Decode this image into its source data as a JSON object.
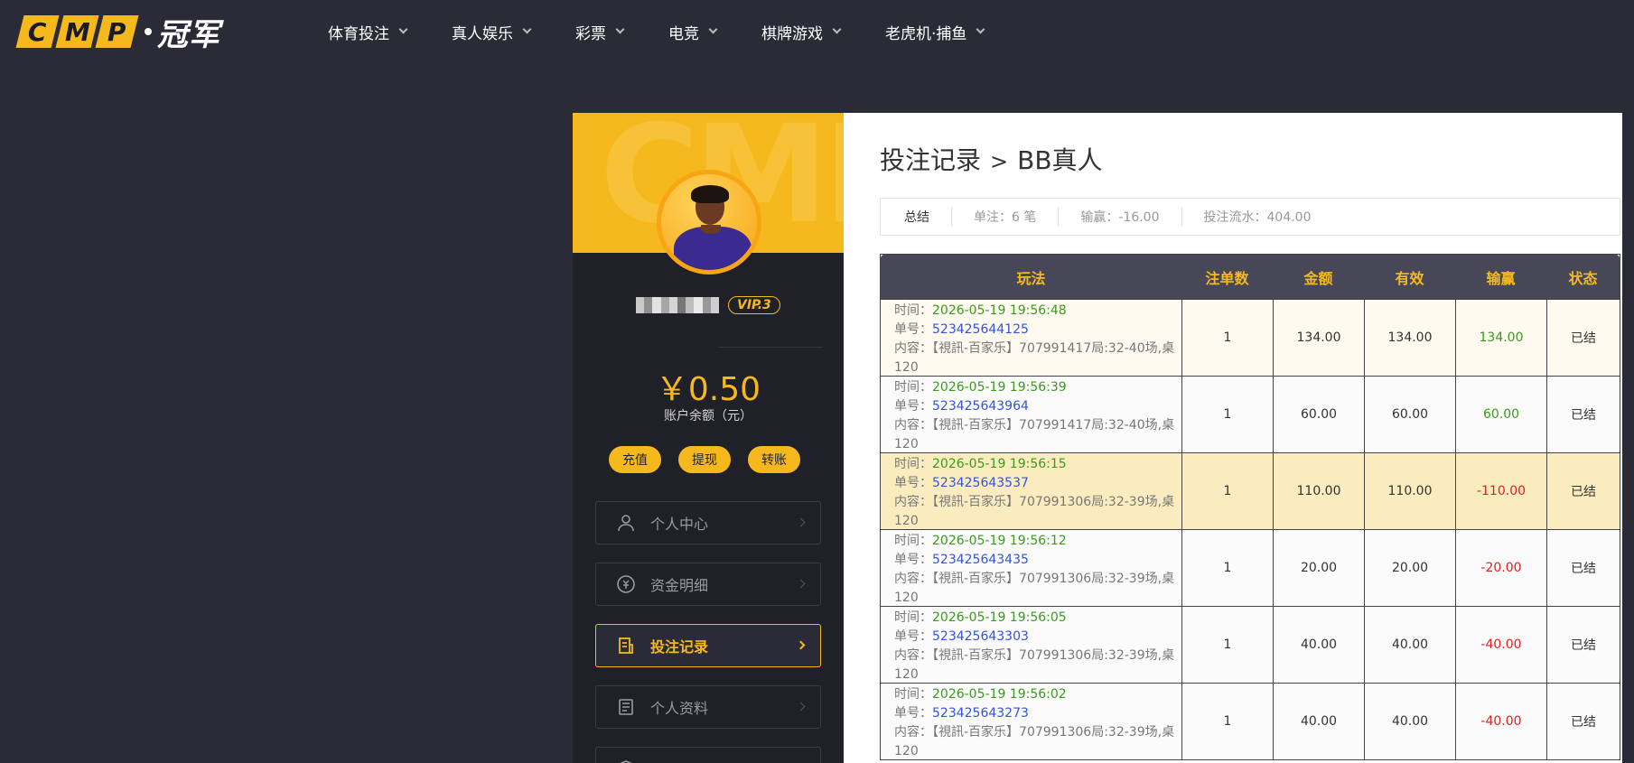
{
  "brand": {
    "logo_letters": [
      "C",
      "M",
      "P"
    ],
    "logo_cn": "冠军",
    "banner_watermark": "CMP"
  },
  "nav": {
    "items": [
      {
        "label": "体育投注"
      },
      {
        "label": "真人娱乐"
      },
      {
        "label": "彩票"
      },
      {
        "label": "电竞"
      },
      {
        "label": "棋牌游戏"
      },
      {
        "label": "老虎机·捕鱼"
      }
    ]
  },
  "user": {
    "vip": "VIP.3",
    "balance": "￥0.50",
    "balance_label": "账户余额（元）"
  },
  "actions": {
    "deposit": "充值",
    "withdraw": "提现",
    "transfer": "转账"
  },
  "menu": {
    "items": [
      {
        "label": "个人中心",
        "icon": "user-icon"
      },
      {
        "label": "资金明细",
        "icon": "money-cycle-icon"
      },
      {
        "label": "投注记录",
        "icon": "bet-record-icon",
        "active": true
      },
      {
        "label": "个人资料",
        "icon": "profile-doc-icon"
      }
    ]
  },
  "page": {
    "title_main": "投注记录",
    "title_sep": ">",
    "title_sub": "BB真人"
  },
  "summary": {
    "label": "总结",
    "bets": "单注：6 笔",
    "winloss": "输赢：-16.00",
    "turnover": "投注流水：404.00"
  },
  "table": {
    "headers": [
      "玩法",
      "注单数",
      "金额",
      "有效",
      "输赢",
      "状态"
    ],
    "time_label": "时间：",
    "no_label": "单号：",
    "content_label": "内容：",
    "rows": [
      {
        "time": "2026-05-19 19:56:48",
        "no": "523425644125",
        "content": "【視訊-百家乐】707991417局:32-40场,桌",
        "content2": "120",
        "count": "1",
        "amount": "134.00",
        "valid": "134.00",
        "winloss": "134.00",
        "status": "已结"
      },
      {
        "time": "2026-05-19 19:56:39",
        "no": "523425643964",
        "content": "【視訊-百家乐】707991417局:32-40场,桌",
        "content2": "120",
        "count": "1",
        "amount": "60.00",
        "valid": "60.00",
        "winloss": "60.00",
        "status": "已结"
      },
      {
        "time": "2026-05-19 19:56:15",
        "no": "523425643537",
        "content": "【視訊-百家乐】707991306局:32-39场,桌",
        "content2": "120",
        "count": "1",
        "amount": "110.00",
        "valid": "110.00",
        "winloss": "-110.00",
        "status": "已结"
      },
      {
        "time": "2026-05-19 19:56:12",
        "no": "523425643435",
        "content": "【視訊-百家乐】707991306局:32-39场,桌",
        "content2": "120",
        "count": "1",
        "amount": "20.00",
        "valid": "20.00",
        "winloss": "-20.00",
        "status": "已结"
      },
      {
        "time": "2026-05-19 19:56:05",
        "no": "523425643303",
        "content": "【視訊-百家乐】707991306局:32-39场,桌",
        "content2": "120",
        "count": "1",
        "amount": "40.00",
        "valid": "40.00",
        "winloss": "-40.00",
        "status": "已结"
      },
      {
        "time": "2026-05-19 19:56:02",
        "no": "523425643273",
        "content": "【視訊-百家乐】707991306局:32-39场,桌",
        "content2": "120",
        "count": "1",
        "amount": "40.00",
        "valid": "40.00",
        "winloss": "-40.00",
        "status": "已结"
      }
    ]
  },
  "colors": {
    "accent": "#f6b91d",
    "background": "#2a2b37",
    "win": "#3a9a1c",
    "lose": "#e02020",
    "link": "#3553d8"
  }
}
